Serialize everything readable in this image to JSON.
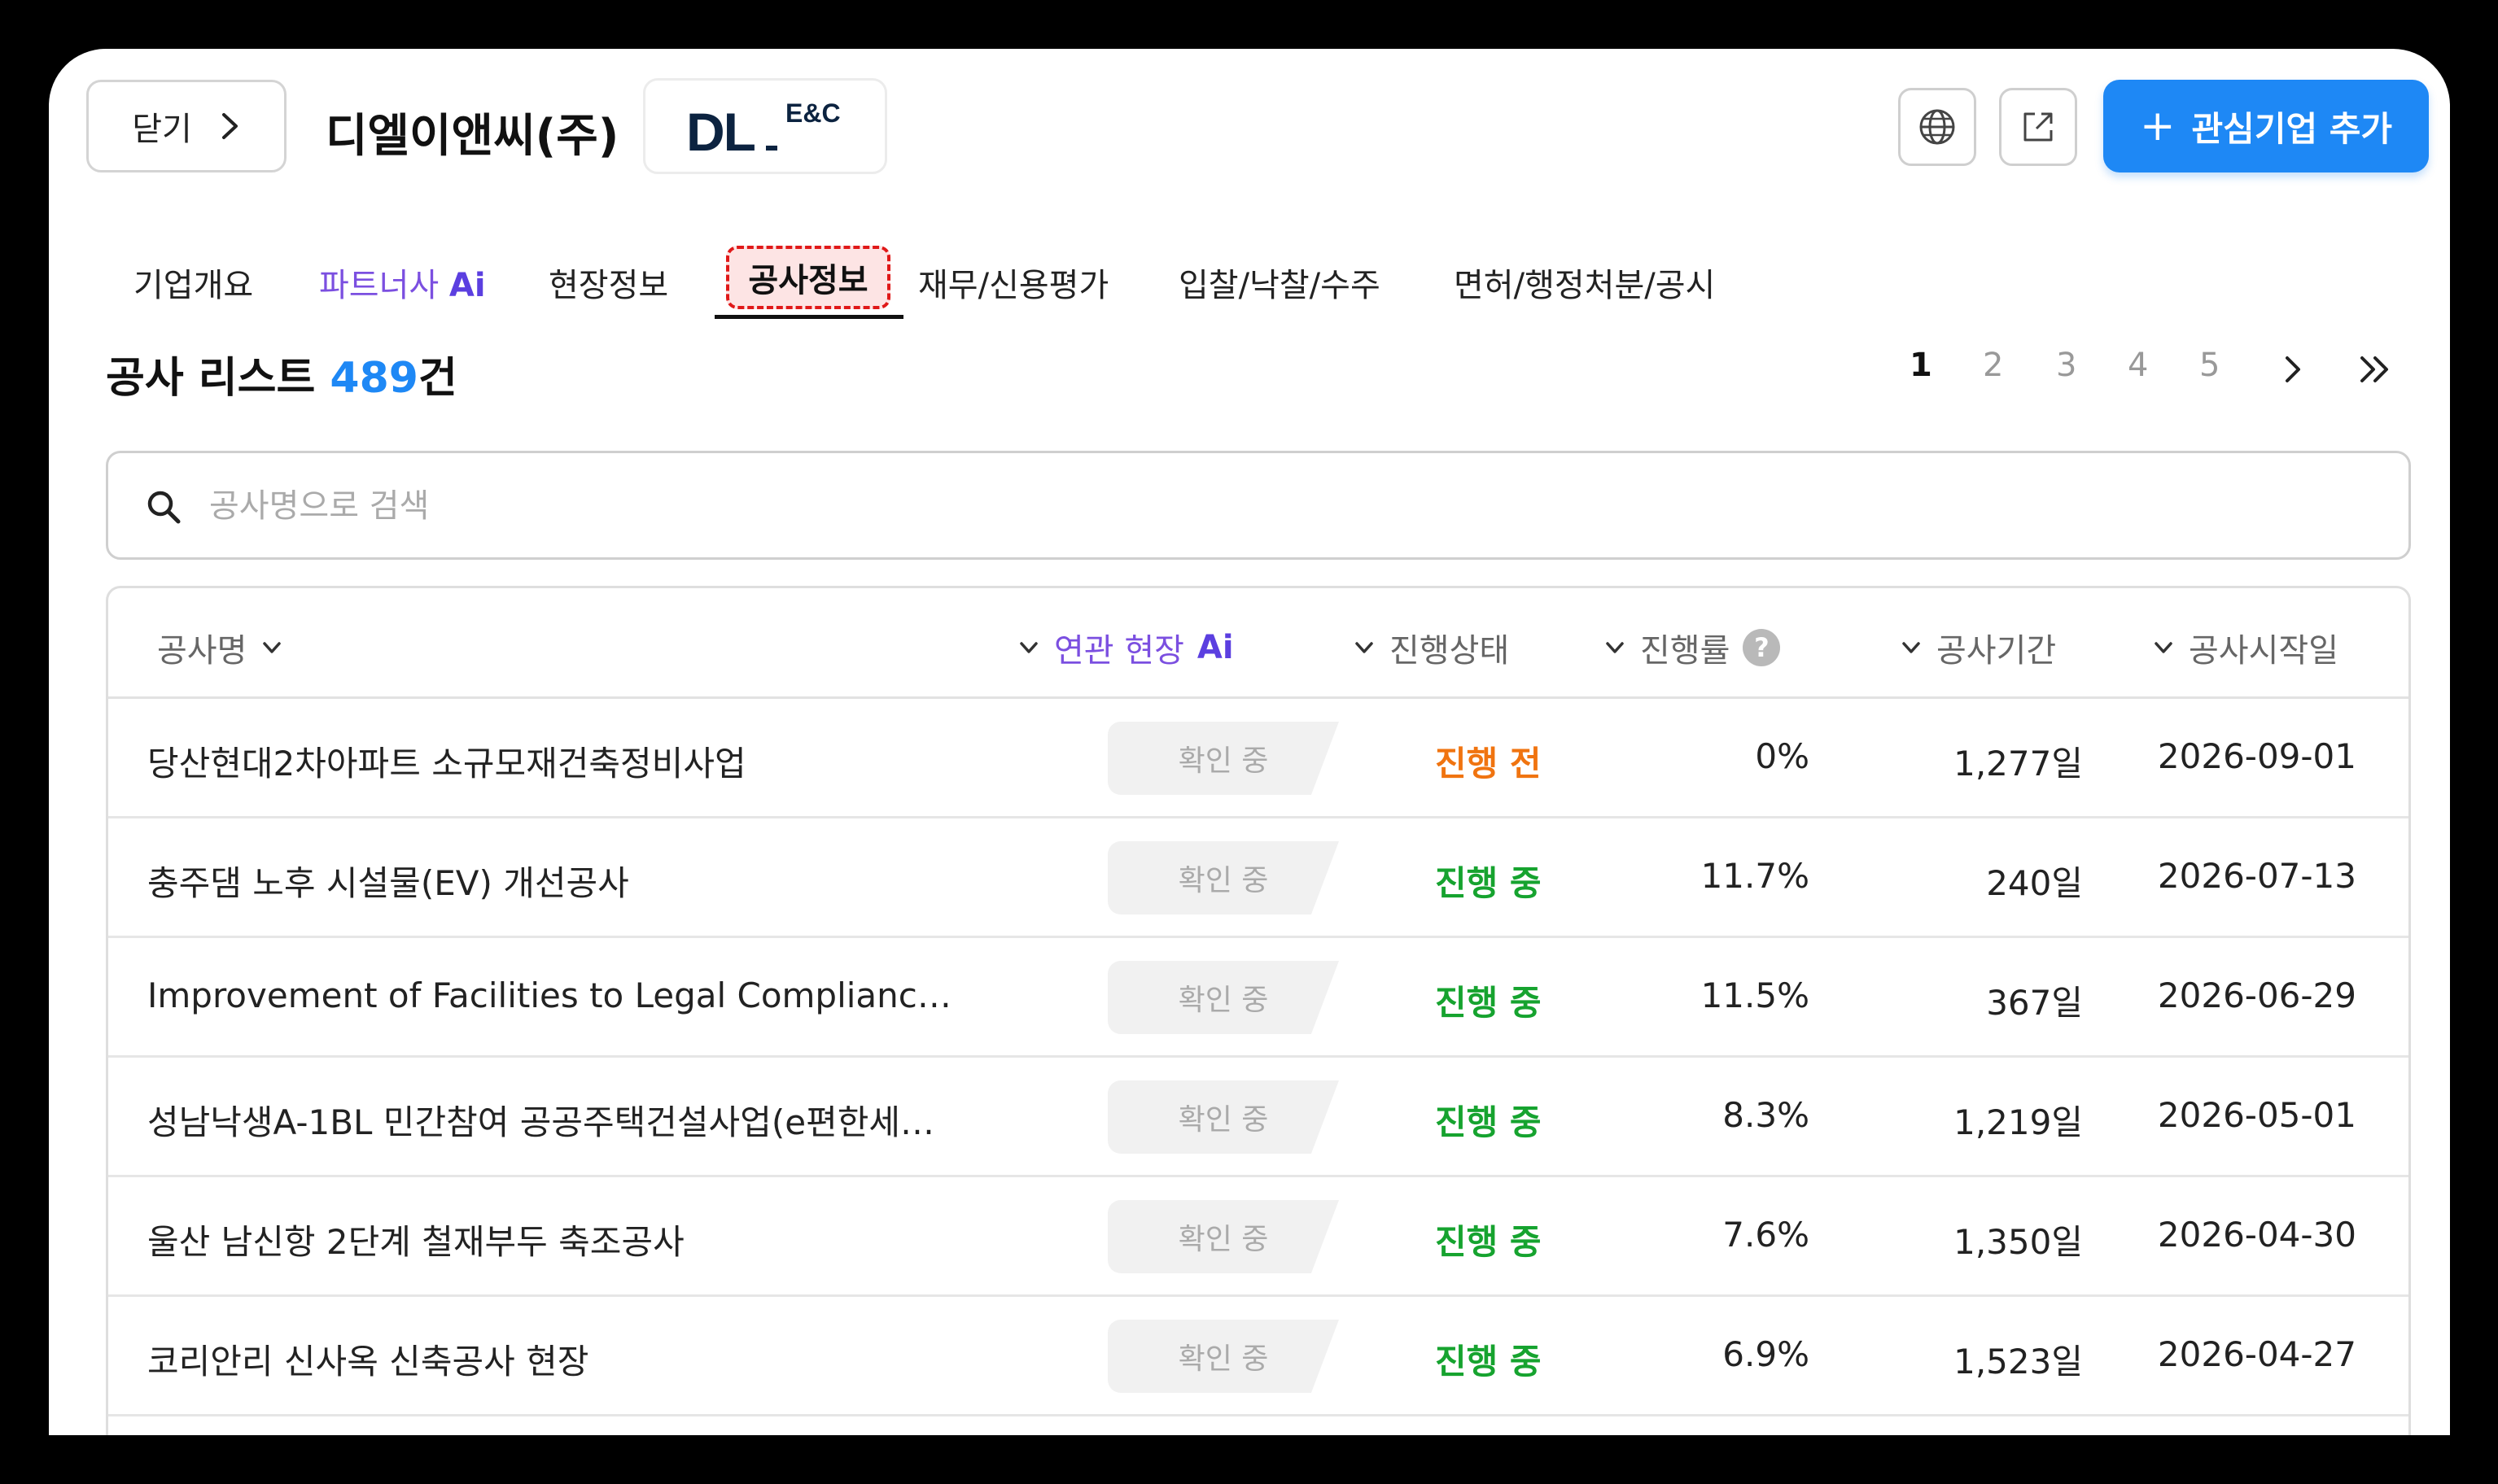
{
  "header": {
    "close_label": "닫기",
    "company_name": "디엘이앤씨(주)",
    "logo_text": "DL",
    "logo_suffix": "E&C",
    "add_button_label": "관심기업 추가"
  },
  "tabs": [
    {
      "label": "기업개요"
    },
    {
      "label": "파트너사",
      "badge": "Ai"
    },
    {
      "label": "현장정보"
    },
    {
      "label": "공사정보",
      "active": true
    },
    {
      "label": "재무/신용평가"
    },
    {
      "label": "입찰/낙찰/수주"
    },
    {
      "label": "면허/행정처분/공시"
    }
  ],
  "list": {
    "title": "공사 리스트",
    "count": "489",
    "count_unit": "건"
  },
  "pagination": {
    "pages": [
      "1",
      "2",
      "3",
      "4",
      "5"
    ],
    "current": "1"
  },
  "search": {
    "placeholder": "공사명으로 검색"
  },
  "table": {
    "columns": {
      "name": "공사명",
      "related": "연관 현장",
      "related_badge": "Ai",
      "status": "진행상태",
      "progress": "진행률",
      "period": "공사기간",
      "start": "공사시작일"
    },
    "rows": [
      {
        "name": "당산현대2차아파트 소규모재건축정비사업",
        "related": "확인 중",
        "status": "진행 전",
        "progress": "0%",
        "period": "1,277일",
        "start": "2026-09-01"
      },
      {
        "name": "충주댐 노후 시설물(EV) 개선공사",
        "related": "확인 중",
        "status": "진행 중",
        "progress": "11.7%",
        "period": "240일",
        "start": "2026-07-13"
      },
      {
        "name": "Improvement of Facilities to Legal Compliance …",
        "related": "확인 중",
        "status": "진행 중",
        "progress": "11.5%",
        "period": "367일",
        "start": "2026-06-29"
      },
      {
        "name": "성남낙생A-1BL 민간참여 공공주택건설사업(e편한세…",
        "related": "확인 중",
        "status": "진행 중",
        "progress": "8.3%",
        "period": "1,219일",
        "start": "2026-05-01"
      },
      {
        "name": "울산 남신항 2단계 철재부두 축조공사",
        "related": "확인 중",
        "status": "진행 중",
        "progress": "7.6%",
        "period": "1,350일",
        "start": "2026-04-30"
      },
      {
        "name": "코리안리 신사옥 신축공사 현장",
        "related": "확인 중",
        "status": "진행 중",
        "progress": "6.9%",
        "period": "1,523일",
        "start": "2026-04-27"
      }
    ]
  },
  "colors": {
    "accent": "#1e88f5",
    "ai": "#5b3fe0",
    "status_before": "#f07410",
    "status_ongoing": "#16a32f",
    "highlight_border": "#e01818"
  },
  "icons": {
    "close": "chevron-right-icon",
    "globe": "globe-icon",
    "external": "external-link-icon",
    "add": "plus-icon",
    "next": "chevron-right-icon",
    "last": "double-chevron-right-icon",
    "search": "search-icon",
    "sort": "chevron-down-icon",
    "help": "help-icon"
  }
}
